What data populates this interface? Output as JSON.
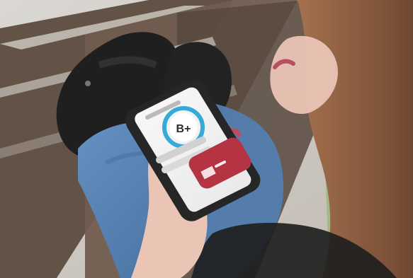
{
  "photo": {
    "grade": "B+",
    "colors": {
      "bench_wood": "#5b4a3e",
      "bench_light": "#c9c2b8",
      "jeans": "#4a78ad",
      "boots": "#141414",
      "phone_body": "#1b1b1b",
      "app_screen": "#f3f3f3",
      "score_ring": "#2aa7d7",
      "app_button_red": "#b02a3a",
      "hair": "#8c5a3c",
      "skin": "#e9c2b2"
    }
  }
}
